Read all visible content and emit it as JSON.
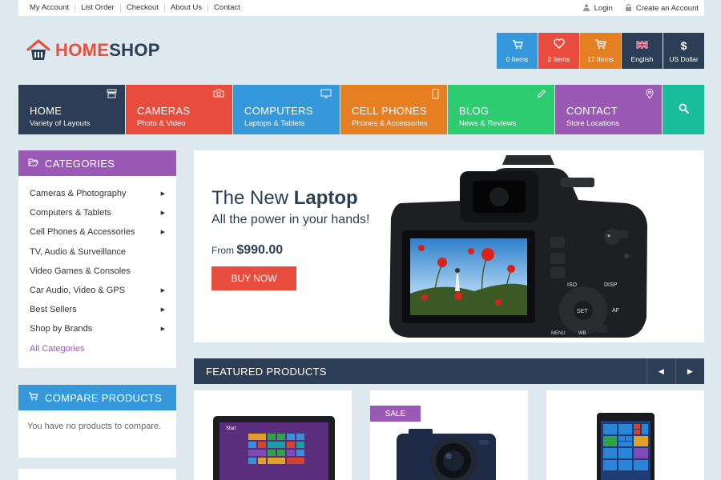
{
  "topbar": {
    "links": [
      "My Account",
      "List Order",
      "Checkout",
      "About Us",
      "Contact"
    ],
    "login": "Login",
    "create_account": "Create an Account"
  },
  "logo": {
    "part1": "HOME",
    "part2": "SHOP"
  },
  "header_tiles": [
    {
      "label": "0 Items",
      "icon": "basket-icon",
      "color": "#3498db"
    },
    {
      "label": "2 Items",
      "icon": "heart-icon",
      "color": "#e74c3c"
    },
    {
      "label": "17 Items",
      "icon": "cart-icon",
      "color": "#e67e22"
    },
    {
      "label": "English",
      "icon": "uk-flag-icon",
      "color": "#2c3e55"
    },
    {
      "label": "US Dollar",
      "symbol": "$",
      "color": "#2c3e55"
    }
  ],
  "nav": [
    {
      "title": "HOME",
      "sub": "Variety of Layouts",
      "icon": "store-icon",
      "color": "#2c3e55"
    },
    {
      "title": "CAMERAS",
      "sub": "Photo & Video",
      "icon": "camera-icon",
      "color": "#e74c3c"
    },
    {
      "title": "COMPUTERS",
      "sub": "Laptops & Tablets",
      "icon": "monitor-icon",
      "color": "#3498db"
    },
    {
      "title": "CELL PHONES",
      "sub": "Phones & Accessories",
      "icon": "phone-icon",
      "color": "#e67e22"
    },
    {
      "title": "BLOG",
      "sub": "News & Reviews",
      "icon": "pencil-icon",
      "color": "#2ecc71"
    },
    {
      "title": "CONTACT",
      "sub": "Store Locations",
      "icon": "map-pin-icon",
      "color": "#9b59b6"
    }
  ],
  "categories": {
    "title": "CATEGORIES",
    "items": [
      {
        "label": "Cameras & Photography",
        "arrow": "▶"
      },
      {
        "label": "Computers & Tablets",
        "arrow": "▶"
      },
      {
        "label": "Cell Phones & Accessories",
        "arrow": "▶"
      },
      {
        "label": "TV, Audio & Surveillance",
        "arrow": ""
      },
      {
        "label": "Video Games & Consoles",
        "arrow": ""
      },
      {
        "label": "Car Audio, Video & GPS",
        "arrow": "▶"
      },
      {
        "label": "Best Sellers",
        "arrow": "▶"
      },
      {
        "label": "Shop by Brands",
        "arrow": "▶"
      },
      {
        "label": "All Categories",
        "arrow": ""
      }
    ]
  },
  "compare": {
    "title": "COMPARE PRODUCTS",
    "text": "You have no products to compare."
  },
  "hero": {
    "title_plain": "The New ",
    "title_bold": "Laptop",
    "subtitle": "All the power in your hands!",
    "from_label": "From ",
    "price": "$990.00",
    "button": "BUY NOW",
    "camera_buttons": [
      "ISO",
      "DISP",
      "SET",
      "AF",
      "MENU",
      "WB"
    ]
  },
  "featured": {
    "title": "FEATURED PRODUCTS",
    "prev": "◀",
    "next": "▶",
    "sale_badge": "SALE",
    "laptop_screen_text": "Start"
  }
}
